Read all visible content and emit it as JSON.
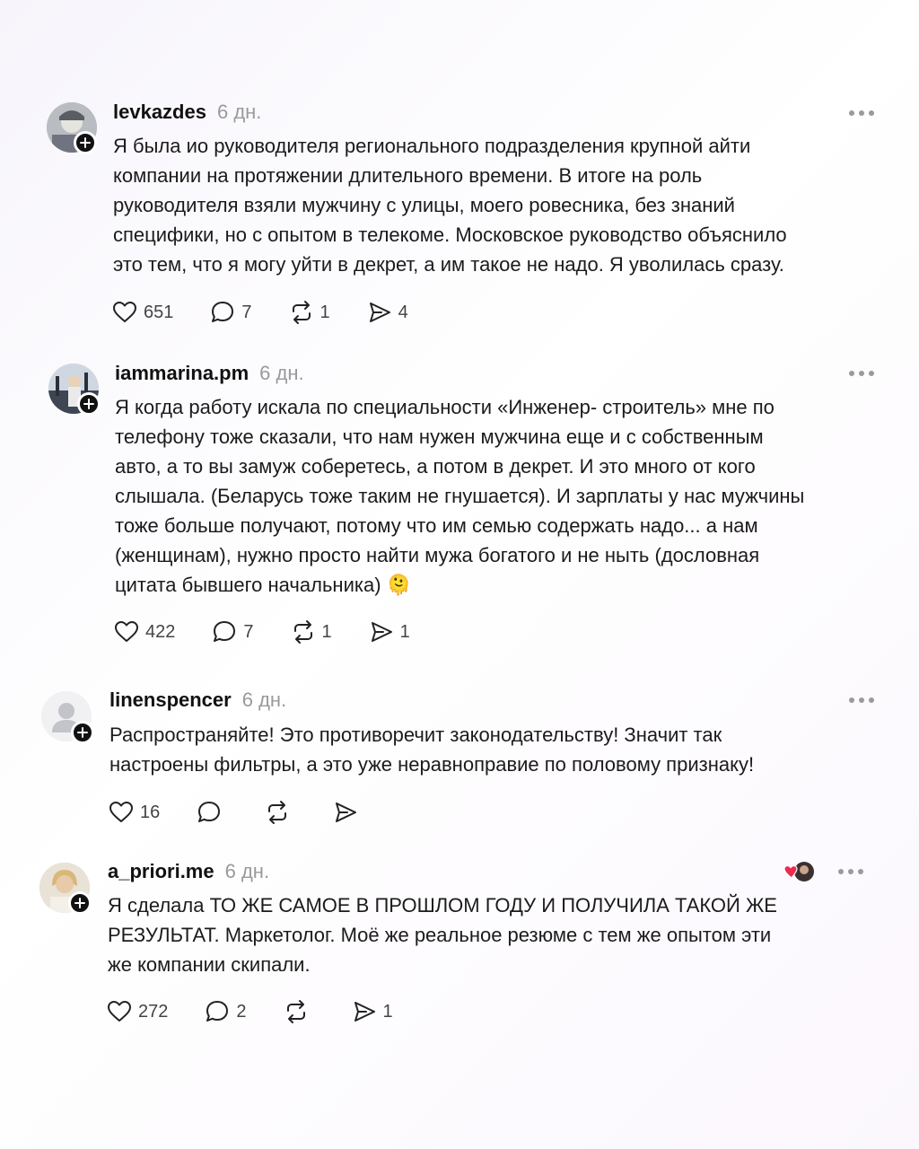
{
  "posts": [
    {
      "username": "levkazdes",
      "time": "6 дн.",
      "text": "Я была ио руководителя регионального подразделения крупной айти\nкомпании на протяжении длительного времени. В итоге на роль\nруководителя взяли мужчину с улицы, моего ровесника, без знаний\nспецифики, но с опытом в телекоме. Московское руководство объяснило\nэто тем, что я могу уйти в декрет, а им такое не надо. Я уволилась сразу.",
      "likes": "651",
      "replies": "7",
      "reposts": "1",
      "shares": "4"
    },
    {
      "username": "iammarina.pm",
      "time": "6 дн.",
      "text": "Я когда работу искала по специальности «Инженер- строитель» мне по\nтелефону тоже сказали, что нам нужен мужчина еще и с собственным\nавто, а то вы замуж соберетесь, а потом в декрет. И это много от кого\nслышала. (Беларусь тоже таким не гнушается). И зарплаты у нас мужчины\nтоже больше получают, потому что им семью содержать надо... а нам\n(женщинам), нужно просто найти мужа богатого и не ныть (дословная\nцитата бывшего начальника) 🫠",
      "likes": "422",
      "replies": "7",
      "reposts": "1",
      "shares": "1"
    },
    {
      "username": "linenspencer",
      "time": "6 дн.",
      "text": "Распространяйте! Это противоречит законодательству! Значит так\nнастроены фильтры, а это уже неравноправие по половому признаку!",
      "likes": "16",
      "replies": "",
      "reposts": "",
      "shares": ""
    },
    {
      "username": "a_priori.me",
      "time": "6 дн.",
      "text": "Я сделала ТО ЖЕ САМОЕ В ПРОШЛОМ ГОДУ И ПОЛУЧИЛА ТАКОЙ ЖЕ\nРЕЗУЛЬТАТ. Маркетолог. Моё же реальное резюме с тем же опытом эти\nже компании скипали.",
      "likes": "272",
      "replies": "2",
      "reposts": "",
      "shares": "1"
    }
  ],
  "icons": {
    "like": "heart-icon",
    "reply": "comment-icon",
    "repost": "repost-icon",
    "share": "share-icon",
    "more": "more-icon",
    "follow": "plus-icon"
  }
}
